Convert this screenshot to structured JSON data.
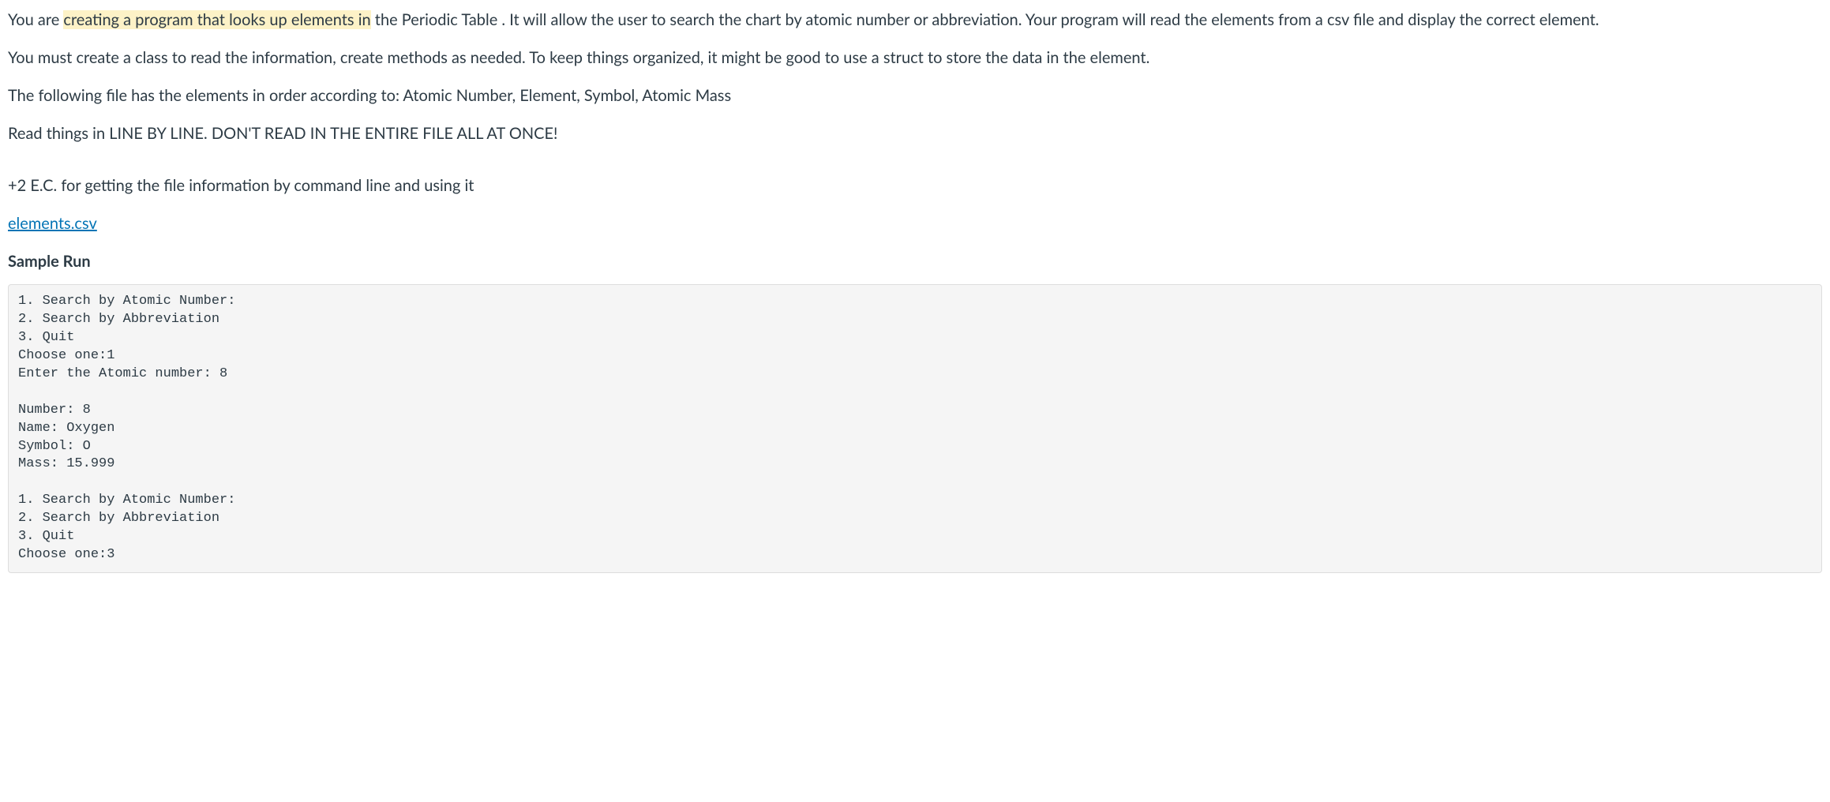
{
  "para1": {
    "pre": "You are ",
    "highlight": "creating a program that looks up elements in",
    "post": " the Periodic Table .  It will allow the user to search the chart by atomic number or abbreviation.  Your program will read the elements from a csv file and display the correct element."
  },
  "para2": " You must create a class to read the information, create methods as needed.  To keep things organized, it might be good to use a struct to store the data in the element.",
  "para3": "The following file has the elements in order according to:  Atomic Number, Element, Symbol, Atomic Mass",
  "para4": "Read things in LINE BY LINE. DON'T READ IN THE ENTIRE FILE ALL AT ONCE!",
  "para5": "+2 E.C. for getting the file information by command line and using it",
  "link_text": "elements.csv",
  "sample_run_heading": "Sample Run",
  "sample_run": "1. Search by Atomic Number:\n2. Search by Abbreviation\n3. Quit\nChoose one:1\nEnter the Atomic number: 8\n\nNumber: 8\nName: Oxygen\nSymbol: O\nMass: 15.999\n\n1. Search by Atomic Number:\n2. Search by Abbreviation\n3. Quit\nChoose one:3"
}
